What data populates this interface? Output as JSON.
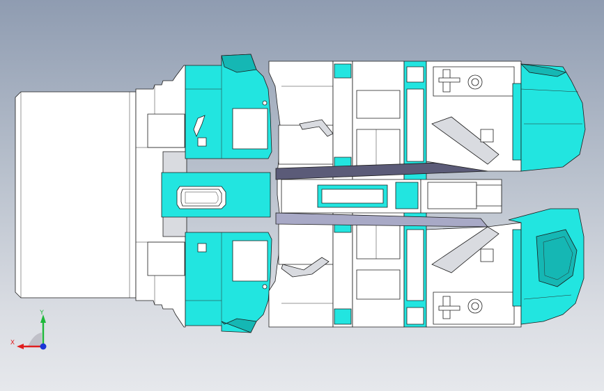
{
  "viewport": {
    "background": "gradient-grey-blue",
    "colors": {
      "part_cyan": "#22e5e0",
      "part_cyan_dark": "#15b7b4",
      "part_white": "#ffffff",
      "part_grey": "#c9ccd6",
      "channel_dark": "#5b5b78",
      "channel_light": "#a8a9c6"
    }
  },
  "model": {
    "name": "",
    "components": [
      "base-block",
      "left-bracket-upper",
      "left-bracket-lower",
      "center-frame",
      "center-channel",
      "right-housing-upper",
      "right-housing-lower"
    ]
  },
  "triad": {
    "x_label": "X",
    "y_label": "Y",
    "x_color": "#e01e1e",
    "y_color": "#1eb83a",
    "z_color": "#1a35d6",
    "origin_icon": "triad-icon"
  }
}
